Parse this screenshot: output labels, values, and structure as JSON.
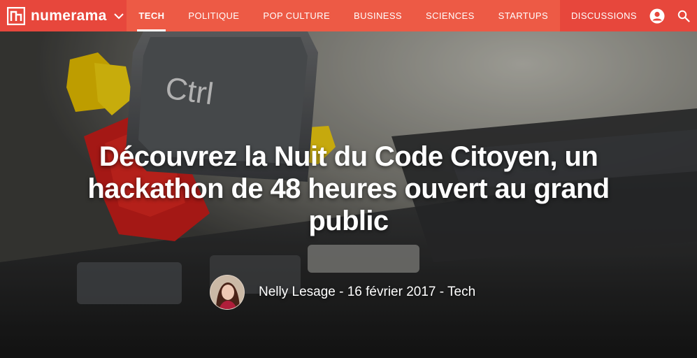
{
  "brand": {
    "name": "numerama",
    "logo_icon": "numerama-logo-icon",
    "menu_icon": "chevron-down-icon"
  },
  "nav": {
    "items": [
      {
        "label": "TECH",
        "active": true
      },
      {
        "label": "POLITIQUE",
        "active": false
      },
      {
        "label": "POP CULTURE",
        "active": false
      },
      {
        "label": "BUSINESS",
        "active": false
      },
      {
        "label": "SCIENCES",
        "active": false
      },
      {
        "label": "STARTUPS",
        "active": false
      }
    ],
    "discussions_label": "DISCUSSIONS",
    "account_icon": "user-account-icon",
    "search_icon": "search-icon"
  },
  "colors": {
    "nav_bg": "#e7473c",
    "nav_items_bg": "#ed5a45",
    "text": "#ffffff"
  },
  "article": {
    "title": "Découvrez la Nuit du Code Citoyen, un hackathon de 48 heures ouvert au grand public",
    "hero_key_label": "Ctrl",
    "author": "Nelly Lesage",
    "separator": "-",
    "date": "16 février 2017",
    "category": "Tech"
  }
}
